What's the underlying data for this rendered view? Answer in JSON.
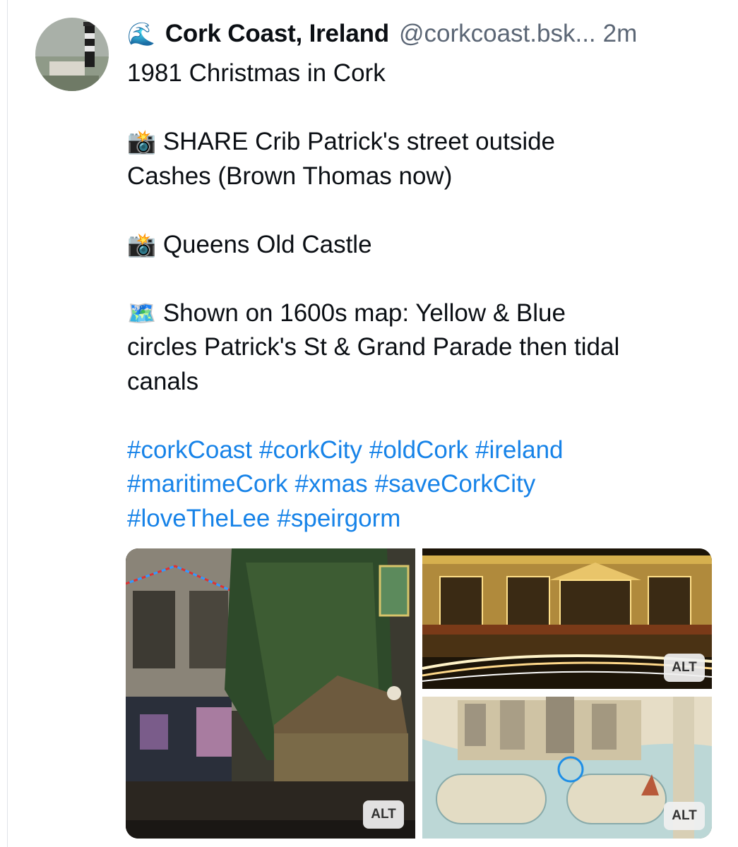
{
  "post": {
    "author": {
      "icon": "water-wave-icon",
      "icon_glyph": "🌊",
      "display_name": "Cork Coast, Ireland",
      "handle": "@corkcoast.bsk...",
      "time": "2m"
    },
    "lines": {
      "title": "1981 Christmas in Cork",
      "p1_icon": "📸",
      "p1_text": "SHARE Crib Patrick's street outside",
      "p1_text2": "Cashes (Brown Thomas now)",
      "p2_icon": "📸",
      "p2_text": "Queens Old Castle",
      "p3_icon": "🗺️",
      "p3_text": "Shown on 1600s map: Yellow & Blue",
      "p3_text2": "circles Patrick's St & Grand Parade then tidal",
      "p3_text3": "canals"
    },
    "hashtags": [
      "#corkCoast",
      "#corkCity",
      "#oldCork",
      "#ireland",
      "#maritimeCork",
      "#xmas",
      "#saveCorkCity",
      "#loveTheLee",
      "#speirgorm"
    ],
    "images": [
      {
        "name": "christmas-crib-photo",
        "alt_label": "ALT"
      },
      {
        "name": "queens-old-castle-photo",
        "alt_label": "ALT"
      },
      {
        "name": "old-cork-map-image",
        "alt_label": "ALT"
      }
    ]
  },
  "colors": {
    "link": "#1783e8",
    "muted": "#5b6675",
    "text": "#0b0f14"
  }
}
